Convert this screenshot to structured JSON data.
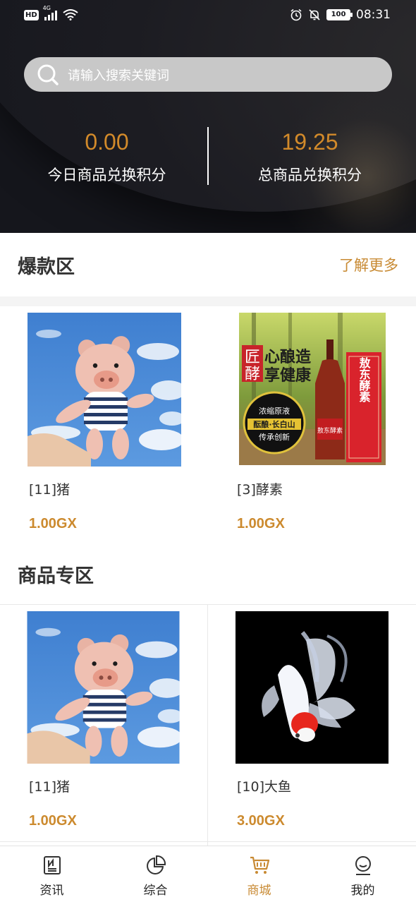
{
  "status_bar": {
    "left_badge": "HD",
    "network": "4G",
    "time": "08:31",
    "battery": "100"
  },
  "search": {
    "placeholder": "请输入搜索关键词"
  },
  "stats": {
    "today_value": "0.00",
    "today_label": "今日商品兑换积分",
    "total_value": "19.25",
    "total_label": "总商品兑换积分"
  },
  "hot_section": {
    "title": "爆款区",
    "more_label": "了解更多",
    "items": [
      {
        "name": "[11]猪",
        "price": "1.00GX",
        "image": "plush-pig-sky"
      },
      {
        "name": "[3]酵素",
        "price": "1.00GX",
        "image": "enzyme-bottle-ad"
      }
    ]
  },
  "product_section": {
    "title": "商品专区",
    "items": [
      {
        "name": "[11]猪",
        "price": "1.00GX",
        "image": "plush-pig-sky"
      },
      {
        "name": "[10]大鱼",
        "price": "3.00GX",
        "image": "goldfish"
      }
    ]
  },
  "enzyme_ad_text": {
    "line1a": "匠",
    "line1b": "酵",
    "slogan1": "心酿造",
    "slogan2": "享健康",
    "circle1": "浓缩原液",
    "circle2": "酝酿·长白山",
    "circle3": "传承创新",
    "bottle": "敖东酵素",
    "box": "敖东酵素"
  },
  "tabs": [
    {
      "label": "资讯",
      "icon": "news-icon",
      "active": false
    },
    {
      "label": "综合",
      "icon": "pie-chart-icon",
      "active": false
    },
    {
      "label": "商城",
      "icon": "cart-icon",
      "active": true
    },
    {
      "label": "我的",
      "icon": "profile-icon",
      "active": false
    }
  ],
  "colors": {
    "accent": "#c88a33",
    "header_bg": "#15161c",
    "search_bg": "#c8c8c8"
  }
}
